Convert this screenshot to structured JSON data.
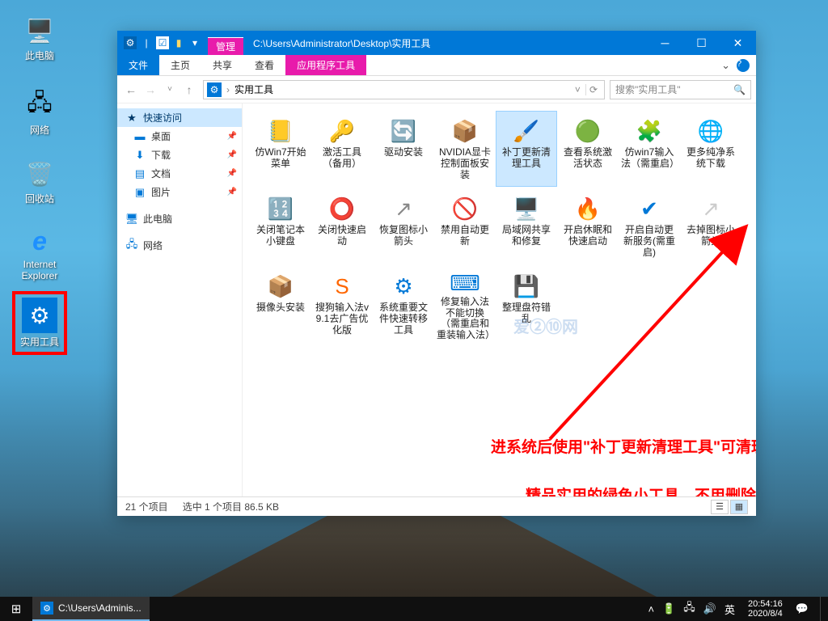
{
  "desktop": {
    "thispc": "此电脑",
    "network": "网络",
    "recycle": "回收站",
    "ie_line1": "Internet",
    "ie_line2": "Explorer",
    "tools": "实用工具"
  },
  "explorer": {
    "title_manage": "管理",
    "title_path": "C:\\Users\\Administrator\\Desktop\\实用工具",
    "tabs": {
      "file": "文件",
      "home": "主页",
      "share": "共享",
      "view": "查看",
      "apptools": "应用程序工具"
    },
    "breadcrumb": "实用工具",
    "search_placeholder": "搜索\"实用工具\"",
    "nav": {
      "quick": "快速访问",
      "desktop": "桌面",
      "downloads": "下载",
      "documents": "文档",
      "pictures": "图片",
      "thispc": "此电脑",
      "network": "网络"
    },
    "files": [
      {
        "label": "仿Win7开始菜单",
        "icon": "📒",
        "color": "#E8B400"
      },
      {
        "label": "激活工具（备用）",
        "icon": "🔑",
        "color": "#E8B400"
      },
      {
        "label": "驱动安装",
        "icon": "🔄",
        "color": "#0078D7"
      },
      {
        "label": "NVIDIA显卡控制面板安装",
        "icon": "📦",
        "color": "#C89058"
      },
      {
        "label": "补丁更新清理工具",
        "icon": "🖌️",
        "color": "#7AC142",
        "selected": true
      },
      {
        "label": "查看系统激活状态",
        "icon": "🟢",
        "color": "#7AC142"
      },
      {
        "label": "仿win7输入法（需重启）",
        "icon": "🧩",
        "color": "#0078D7"
      },
      {
        "label": "更多纯净系统下载",
        "icon": "🌐",
        "color": "#0078D7"
      },
      {
        "label": "关闭笔记本小键盘",
        "icon": "🔢",
        "color": "#888"
      },
      {
        "label": "关闭快速启动",
        "icon": "⭕",
        "color": "#0078D7"
      },
      {
        "label": "恢复图标小箭头",
        "icon": "↗",
        "color": "#888"
      },
      {
        "label": "禁用自动更新",
        "icon": "🚫",
        "color": "#E81123"
      },
      {
        "label": "局域网共享和修复",
        "icon": "🖥️",
        "color": "#0078D7"
      },
      {
        "label": "开启休眠和快速启动",
        "icon": "🔥",
        "color": "#FF8800"
      },
      {
        "label": "开启自动更新服务(需重启)",
        "icon": "✔",
        "color": "#0078D7"
      },
      {
        "label": "去掉图标小箭头",
        "icon": "↗",
        "color": "#ccc"
      },
      {
        "label": "摄像头安装",
        "icon": "📦",
        "color": "#E8B400"
      },
      {
        "label": "搜狗输入法v9.1去广告优化版",
        "icon": "S",
        "color": "#FF6600"
      },
      {
        "label": "系统重要文件快速转移工具",
        "icon": "⚙",
        "color": "#0078D7"
      },
      {
        "label": "修复输入法不能切换（需重启和重装输入法）",
        "icon": "⌨",
        "color": "#0078D7"
      },
      {
        "label": "整理盘符错乱",
        "icon": "💾",
        "color": "#00B294"
      }
    ],
    "status": {
      "count": "21 个项目",
      "selected": "选中 1 个项目  86.5 KB"
    }
  },
  "annotations": {
    "line1": "进系统后使用\"补丁更新清理工具\"可清理系统补丁垃圾文件",
    "line2": "精品实用的绿色小工具，不用删除即可"
  },
  "taskbar": {
    "task": "C:\\Users\\Adminis...",
    "ime": "英",
    "time": "20:54:16",
    "date": "2020/8/4"
  }
}
